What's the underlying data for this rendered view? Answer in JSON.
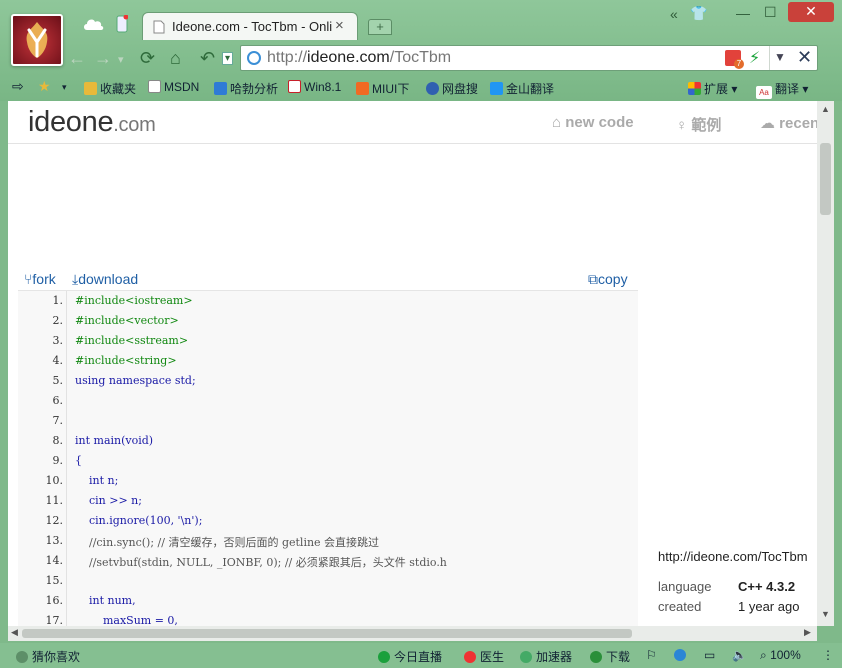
{
  "tab": {
    "title": "Ideone.com - TocTbm - Onli",
    "close": "×",
    "new_tab": "+"
  },
  "window": {
    "minimize": "—",
    "maximize": "☐",
    "close": "✕",
    "skin": "👕",
    "collapse": "«"
  },
  "address": {
    "prefix": "http://",
    "domain": "ideone.com",
    "path": "/TocTbm",
    "badge": "7"
  },
  "bookmarks": [
    {
      "label": "收藏夹",
      "color": "#e8b93a"
    },
    {
      "label": "MSDN",
      "color": "#ffffff"
    },
    {
      "label": "哈勃分析",
      "color": "#2f7bd6"
    },
    {
      "label": "Win8.1",
      "color": "#c8202a"
    },
    {
      "label": "MIUI下",
      "color": "#f06a23"
    },
    {
      "label": "网盘搜",
      "color": "#3060b0"
    },
    {
      "label": "金山翻译",
      "color": "#2196f3"
    }
  ],
  "bookmarks_right": {
    "extend": "扩展",
    "translate": "翻译",
    "translate_icon": "Aa"
  },
  "site": {
    "brand_main": "ideone",
    "brand_suffix": ".com",
    "nav": [
      "new code",
      "範例",
      "recen"
    ]
  },
  "actions": {
    "fork": "fork",
    "download": "download",
    "copy": "copy"
  },
  "code": {
    "lines": [
      {
        "n": "1.",
        "text": "#include<iostream>",
        "type": "pp"
      },
      {
        "n": "2.",
        "text": "#include<vector>",
        "type": "pp"
      },
      {
        "n": "3.",
        "text": "#include<sstream>",
        "type": "pp"
      },
      {
        "n": "4.",
        "text": "#include<string>",
        "type": "pp"
      },
      {
        "n": "5.",
        "text": "using namespace std;",
        "type": "kw"
      },
      {
        "n": "6.",
        "text": "",
        "type": ""
      },
      {
        "n": "7.",
        "text": "",
        "type": ""
      },
      {
        "n": "8.",
        "text": "int main(void)",
        "type": "kw"
      },
      {
        "n": "9.",
        "text": "{",
        "type": "kw"
      },
      {
        "n": "10.",
        "text": "    int n;",
        "type": "kw"
      },
      {
        "n": "11.",
        "text": "    cin >> n;",
        "type": "kw"
      },
      {
        "n": "12.",
        "text": "    cin.ignore(100, '\\n');",
        "type": "kw"
      },
      {
        "n": "13.",
        "text": "    //cin.sync(); // 清空缓存，否则后面的 getline 会直接跳过",
        "type": "cm"
      },
      {
        "n": "14.",
        "text": "    //setvbuf(stdin, NULL, _IONBF, 0); // 必须紧跟其后，头文件 stdio.h",
        "type": "cm"
      },
      {
        "n": "15.",
        "text": "",
        "type": ""
      },
      {
        "n": "16.",
        "text": "    int num,",
        "type": "kw"
      },
      {
        "n": "17.",
        "text": "        maxSum = 0,",
        "type": "kw"
      }
    ]
  },
  "info": {
    "url": "http://ideone.com/TocTbm",
    "language_label": "language",
    "language_value": "C++ 4.3.2",
    "created_label": "created",
    "created_value": "1 year ago"
  },
  "status": {
    "guess": "猜你喜欢",
    "live": "今日直播",
    "doctor": "医生",
    "accelerator": "加速器",
    "download": "下载",
    "zoom": "100%"
  }
}
